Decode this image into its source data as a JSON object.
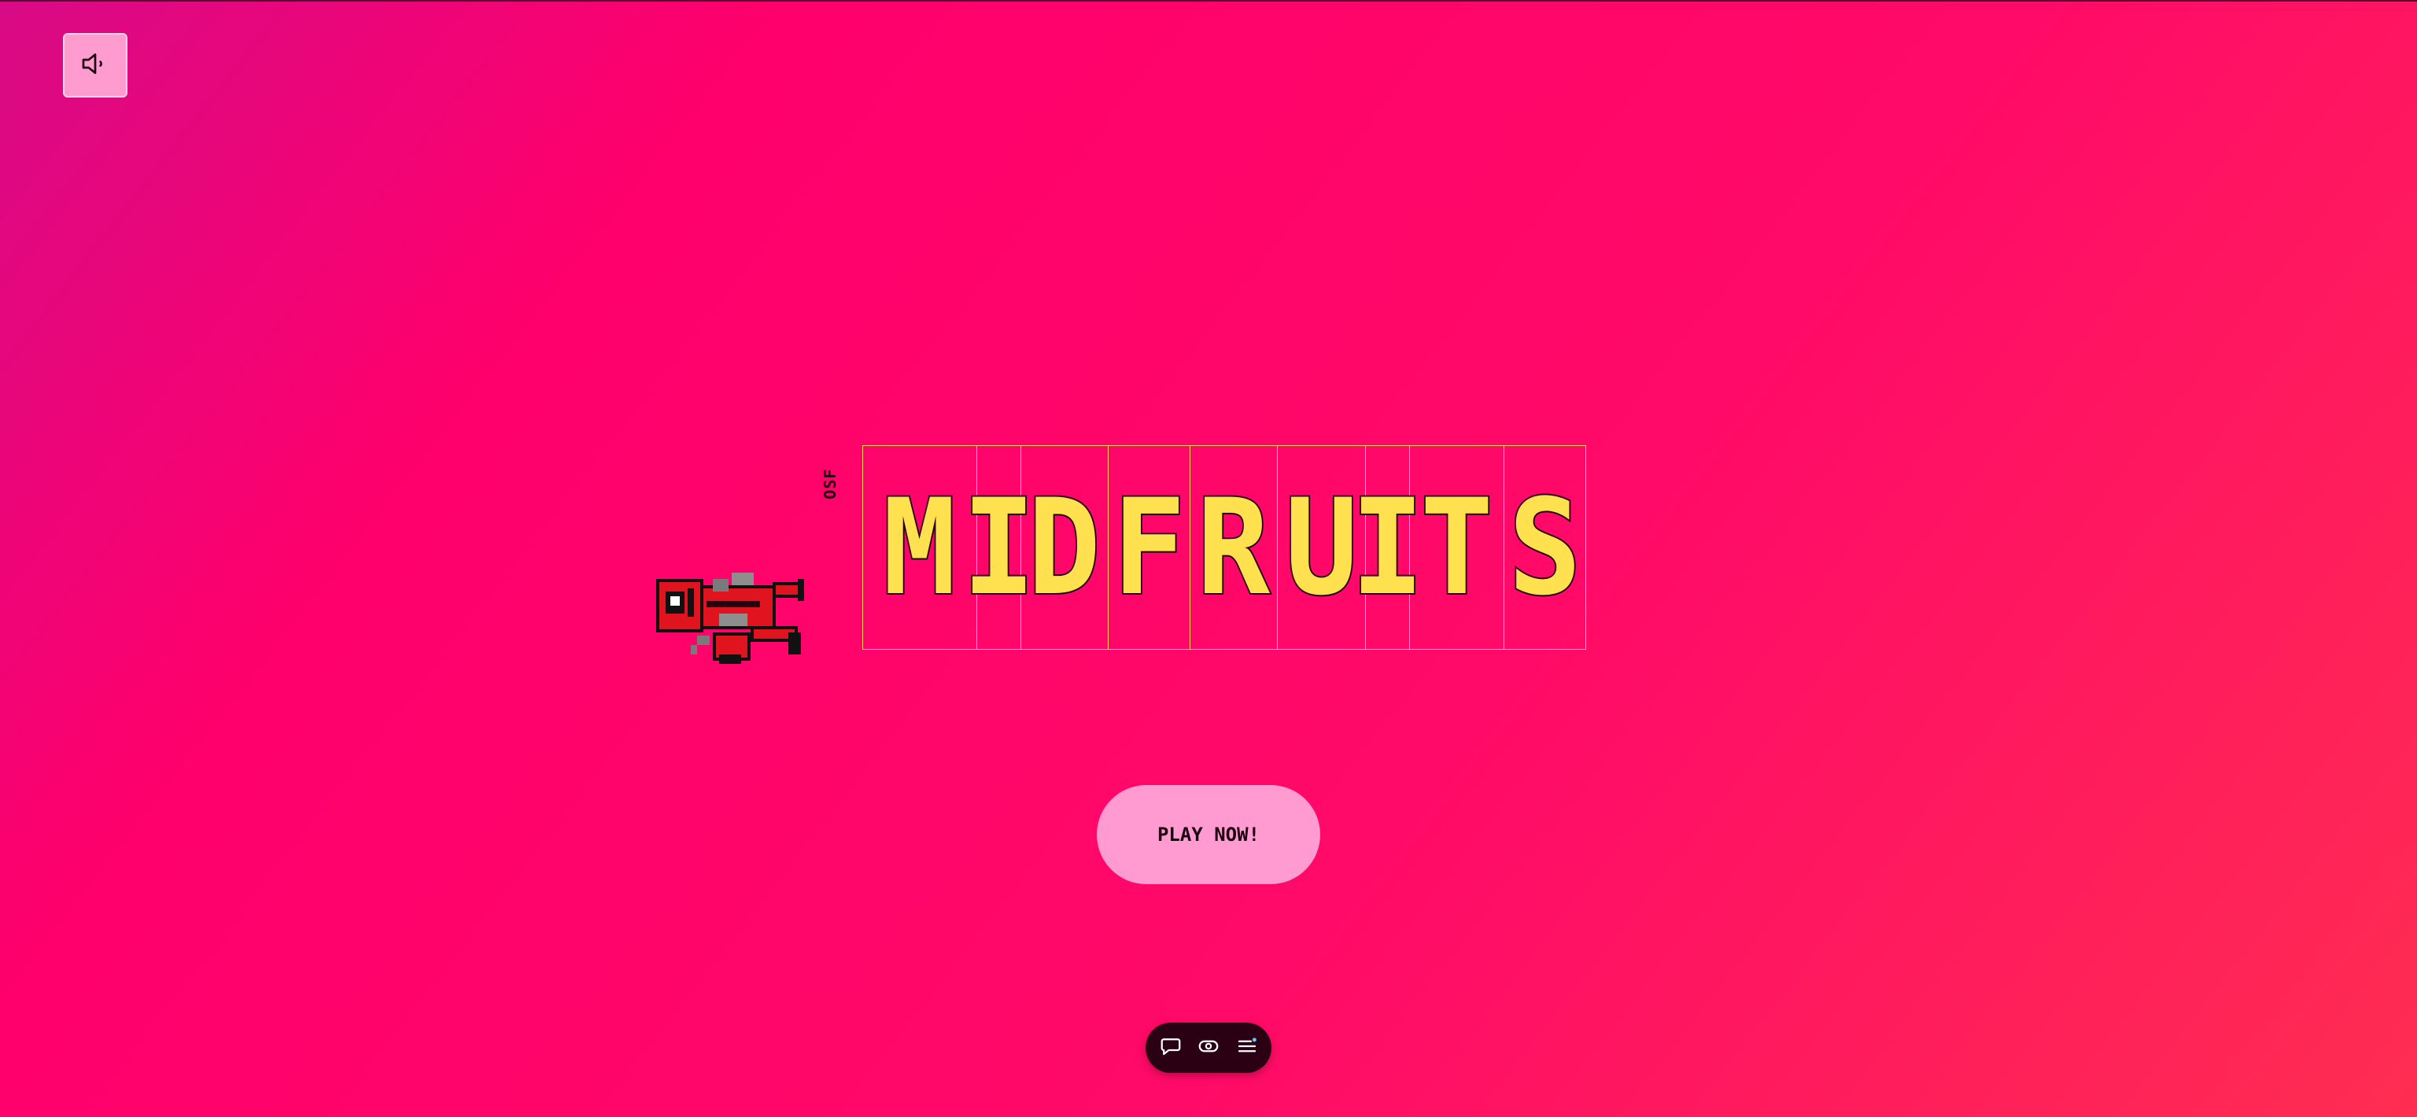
{
  "hud": {
    "sound_icon": "speaker-icon"
  },
  "title": {
    "small_label": "OSF",
    "letters": [
      "M",
      "I",
      "D",
      "F",
      "R",
      "U",
      "I",
      "T",
      "S"
    ],
    "letter_color": "#ffe04e"
  },
  "menu": {
    "play_label": "PLAY NOW!"
  },
  "toolbar": {
    "icons": [
      "chat-bubble-icon",
      "eye-icon",
      "menu-lines-icon"
    ]
  }
}
